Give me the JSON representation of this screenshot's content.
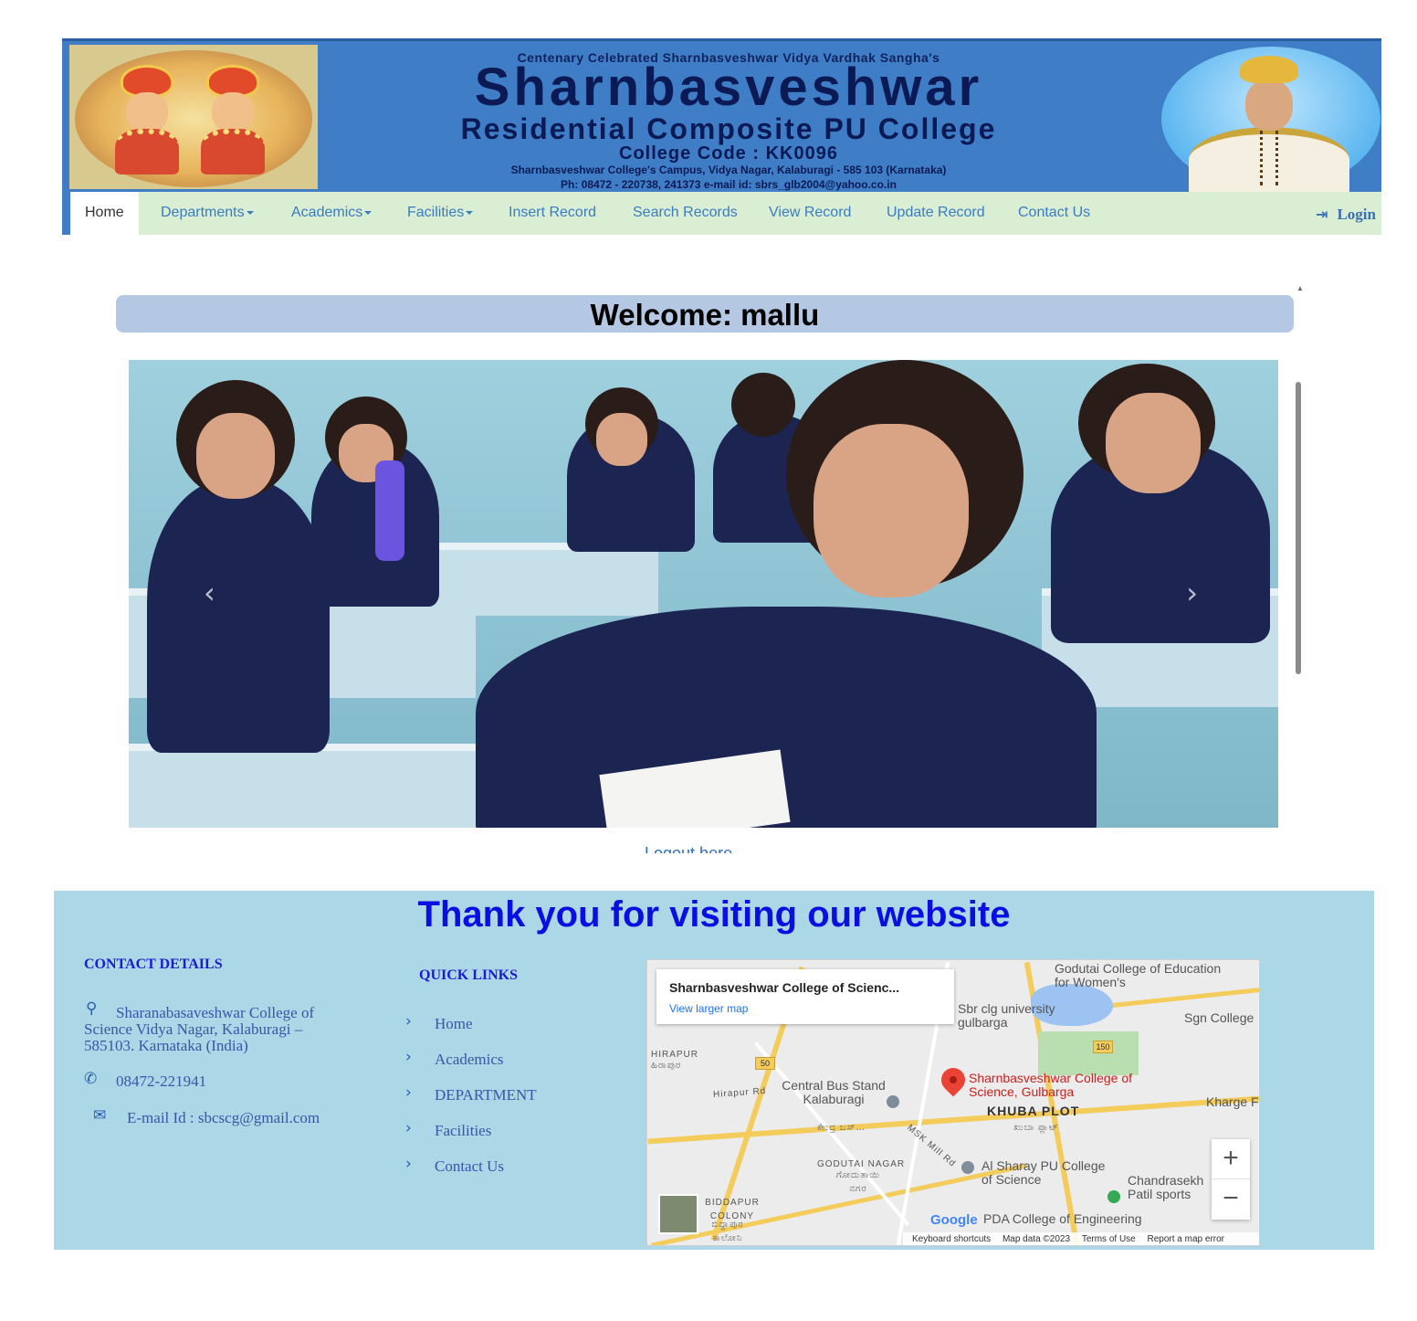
{
  "header": {
    "tagline": "Centenary Celebrated Sharnbasveshwar Vidya Vardhak Sangha's",
    "title": "Sharnbasveshwar",
    "subtitle": "Residential Composite PU College",
    "college_code": "College Code : KK0096",
    "address": "Sharnbasveshwar College's Campus, Vidya Nagar, Kalaburagi - 585 103 (Karnataka)",
    "contact": "Ph: 08472 - 220738, 241373     e-mail id: sbrs_glb2004@yahoo.co.in",
    "banner_color": "#3f7ec6"
  },
  "nav": {
    "items": [
      {
        "label": "Home",
        "active": true
      },
      {
        "label": "Departments",
        "dropdown": true
      },
      {
        "label": "Academics",
        "dropdown": true
      },
      {
        "label": "Facilities",
        "dropdown": true
      },
      {
        "label": "Insert Record"
      },
      {
        "label": "Search Records"
      },
      {
        "label": "View Record"
      },
      {
        "label": "Update Record"
      },
      {
        "label": "Contact Us"
      }
    ],
    "login_label": "Login",
    "bar_color": "#daeed4",
    "link_color": "#3a7cc0"
  },
  "main": {
    "welcome": "Welcome: mallu",
    "carousel_prev_icon": "chevron-left-icon",
    "carousel_next_icon": "chevron-right-icon",
    "logout_text": "Logout here"
  },
  "footer": {
    "thanks": "Thank you for visiting our website",
    "contact_heading": "CONTACT DETAILS",
    "address_line1": "Sharanabasaveshwar   College   of",
    "address_line2": "Science   Vidya   Nagar,   Kalaburagi   –",
    "address_line3": "585103.   Karnataka   (India)",
    "phone": "08472-221941",
    "email": "E-mail   Id   :   sbcscg@gmail.com",
    "quick_links_heading": "QUICK LINKS",
    "quick_links": [
      "Home",
      "Academics",
      "DEPARTMENT",
      "Facilities",
      "Contact   Us"
    ],
    "background": "#abd7e6"
  },
  "map": {
    "place_title": "Sharnbasveshwar College of Scienc...",
    "larger_map": "View larger map",
    "labels": {
      "godutai_college": "Godutai College of Education for Women's",
      "sbr_clg": "Sbr clg university gulbarga",
      "sgn_college": "Sgn College",
      "hirapur": "HIRAPUR",
      "hirapur_kn": "ಹಿರಾಪುರ",
      "hirapur_rd": "Hirapur Rd",
      "central_bus": "Central Bus Stand Kalaburagi",
      "central_bus_kn": "ಕೇಂದ್ರ ಬಸ್…",
      "marker_place": "Sharnbasveshwar College of Science, Gulbarga",
      "khuba_plot": "KHUBA PLOT",
      "khuba_plot_kn": "ಖುಬಾ ಪ್ಲಾಟ್",
      "kharge": "Kharge F",
      "msk_mill": "MSK Mill Rd",
      "godutai_nagar": "GODUTAI NAGAR",
      "godutai_nagar_kn": "ಗೋದುತಾಯಿ ನಗರ",
      "al_sharay": "Al Sharay PU College of Science",
      "chandrasekhar": "Chandrasekh Patil sports",
      "biddapur": "BIDDAPUR COLONY",
      "biddapur_kn": "ಬಿದ್ದಾಪುರ ಕಾಲೋನಿ",
      "pda_college": "PDA College of Engineering",
      "route_50": "50",
      "route_150": "150"
    },
    "google": "Google",
    "footer_links": [
      "Keyboard shortcuts",
      "Map data ©2023",
      "Terms of Use",
      "Report a map error"
    ],
    "zoom_in": "+",
    "zoom_out": "−"
  }
}
